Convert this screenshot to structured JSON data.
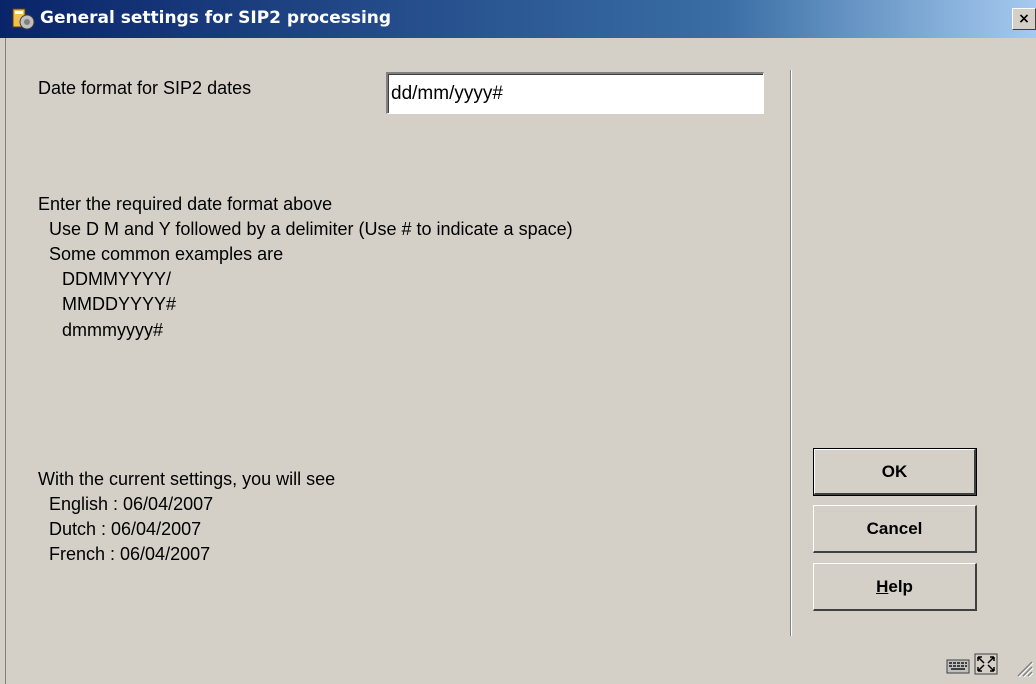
{
  "window": {
    "title": "General settings for SIP2 processing",
    "close_label": "×"
  },
  "form": {
    "date_format_label": "Date format for SIP2 dates",
    "date_format_value": "dd/mm/yyyy#"
  },
  "help": {
    "line1": "Enter the required date format above",
    "line2": "Use D M and Y followed by a delimiter (Use # to indicate a space)",
    "line3": "Some common examples are",
    "examples": [
      "DDMMYYYY/",
      "MMDDYYYY#",
      "dmmmyyyy#"
    ]
  },
  "preview": {
    "heading": "With the current settings, you will see",
    "english": "English : 06/04/2007",
    "dutch": "Dutch : 06/04/2007",
    "french": "French : 06/04/2007"
  },
  "buttons": {
    "ok": "OK",
    "cancel": "Cancel",
    "help_first": "H",
    "help_rest": "elp"
  },
  "icons": {
    "title": "app-window-icon",
    "keyboard": "keyboard-icon",
    "maximize": "expand-icon",
    "grip": "resize-grip-icon"
  }
}
